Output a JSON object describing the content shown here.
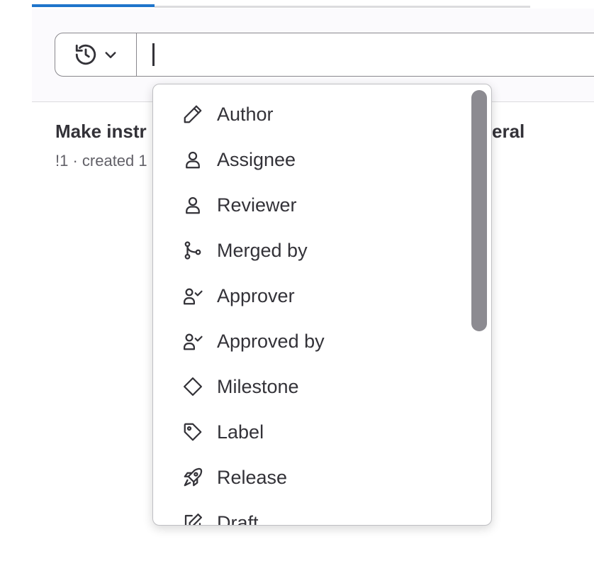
{
  "tabs": {
    "accent_color": "#1f75cb"
  },
  "filter_bar": {
    "history_icon": "history-icon",
    "dropdown_chevron_icon": "chevron-down-icon",
    "search_value": "",
    "border_color": "#89888d"
  },
  "merge_request": {
    "title_start": "Make instr",
    "title_end": "eral",
    "meta": "!1 · created 1"
  },
  "dropdown": {
    "items": [
      {
        "label": "Author",
        "icon": "pencil-icon"
      },
      {
        "label": "Assignee",
        "icon": "user-icon"
      },
      {
        "label": "Reviewer",
        "icon": "user-icon"
      },
      {
        "label": "Merged by",
        "icon": "merge-icon"
      },
      {
        "label": "Approver",
        "icon": "approval-user-icon"
      },
      {
        "label": "Approved by",
        "icon": "approval-user-icon"
      },
      {
        "label": "Milestone",
        "icon": "milestone-icon"
      },
      {
        "label": "Label",
        "icon": "label-icon"
      },
      {
        "label": "Release",
        "icon": "rocket-icon"
      },
      {
        "label": "Draft",
        "icon": "draft-icon"
      }
    ]
  }
}
